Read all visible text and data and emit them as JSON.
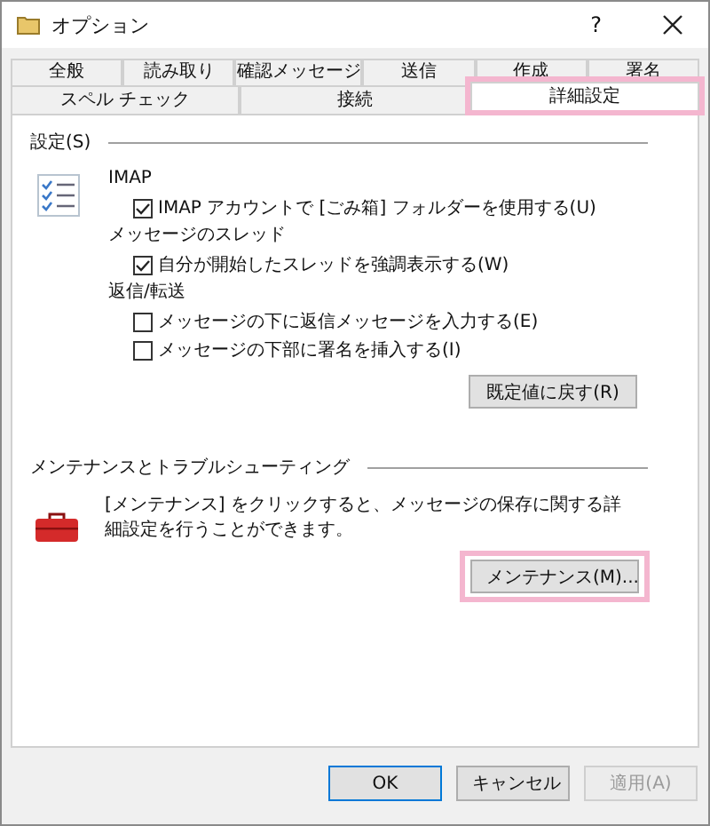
{
  "window": {
    "title": "オプション",
    "help": "?"
  },
  "tab_rows": [
    [
      {
        "label": "全般",
        "selected": false
      },
      {
        "label": "読み取り",
        "selected": false
      },
      {
        "label": "確認メッセージ",
        "selected": false
      },
      {
        "label": "送信",
        "selected": false
      },
      {
        "label": "作成",
        "selected": false
      },
      {
        "label": "署名",
        "selected": false
      }
    ],
    [
      {
        "label": "スペル チェック",
        "selected": false
      },
      {
        "label": "接続",
        "selected": false
      },
      {
        "label": "詳細設定",
        "selected": true,
        "highlighted": true
      }
    ]
  ],
  "settings": {
    "title": "設定(S)",
    "sections": [
      {
        "heading": "IMAP",
        "options": [
          {
            "label": "IMAP アカウントで [ごみ箱] フォルダーを使用する(U)",
            "checked": true
          }
        ]
      },
      {
        "heading": "メッセージのスレッド",
        "options": [
          {
            "label": "自分が開始したスレッドを強調表示する(W)",
            "checked": true
          }
        ]
      },
      {
        "heading": "返信/転送",
        "options": [
          {
            "label": "メッセージの下に返信メッセージを入力する(E)",
            "checked": false
          },
          {
            "label": "メッセージの下部に署名を挿入する(I)",
            "checked": false
          }
        ]
      }
    ],
    "reset_button": "既定値に戻す(R)"
  },
  "maintenance": {
    "title": "メンテナンスとトラブルシューティング",
    "description": "[メンテナンス] をクリックすると、メッセージの保存に関する詳細設定を行うことができます。",
    "button": {
      "label": "メンテナンス(M)...",
      "highlighted": true
    }
  },
  "buttons": [
    {
      "label": "OK",
      "default": true,
      "disabled": false
    },
    {
      "label": "キャンセル",
      "default": false,
      "disabled": false
    },
    {
      "label": "適用(A)",
      "default": false,
      "disabled": true
    }
  ]
}
